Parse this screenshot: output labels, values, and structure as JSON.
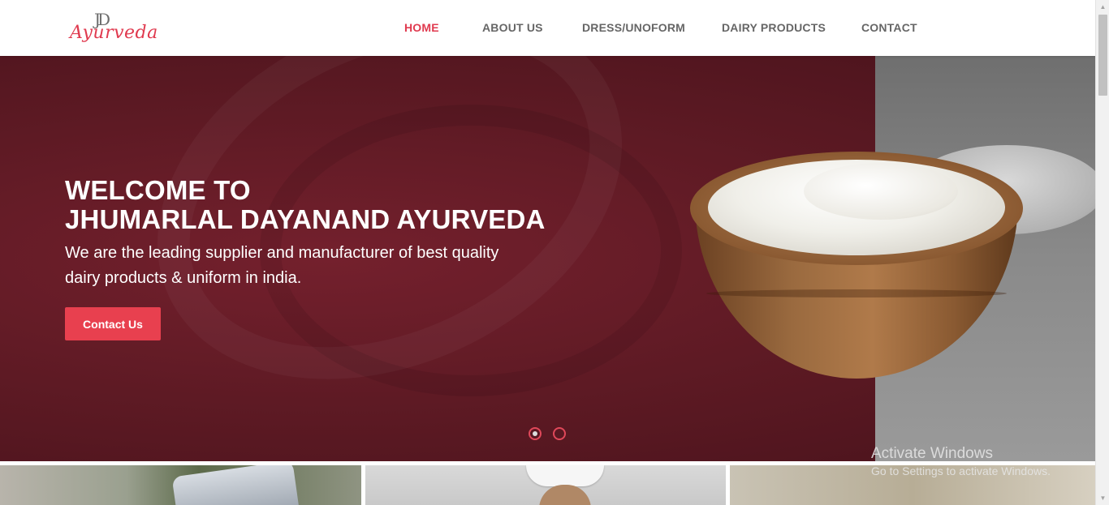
{
  "header": {
    "logo": {
      "mark": "JD",
      "text": "Ayurveda"
    },
    "nav": [
      {
        "label": "HOME",
        "active": true
      },
      {
        "label": "ABOUT US",
        "active": false
      },
      {
        "label": "DRESS/UNOFORM",
        "active": false
      },
      {
        "label": "DAIRY PRODUCTS",
        "active": false
      },
      {
        "label": "CONTACT",
        "active": false
      }
    ]
  },
  "hero": {
    "title_line1": "WELCOME TO",
    "title_line2": "JHUMARLAL DAYANAND AYURVEDA",
    "subtitle": "We are the leading supplier and manufacturer of best quality dairy products & uniform in india.",
    "cta_label": "Contact Us",
    "slides": {
      "count": 2,
      "active_index": 0
    }
  },
  "watermark": {
    "title": "Activate Windows",
    "subtitle": "Go to Settings to activate Windows."
  },
  "colors": {
    "accent": "#e8404f",
    "hero_bg": "#5e1a24",
    "nav_text": "#666666"
  }
}
